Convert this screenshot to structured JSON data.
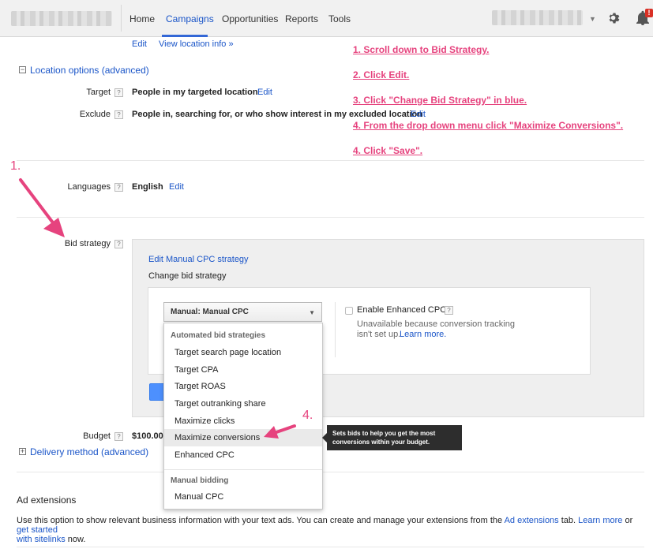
{
  "nav": {
    "tabs": [
      {
        "label": "Home"
      },
      {
        "label": "Campaigns"
      },
      {
        "label": "Opportunities"
      },
      {
        "label": "Reports"
      },
      {
        "label": "Tools"
      }
    ],
    "notification_badge": "!"
  },
  "location": {
    "edit_label": "Edit",
    "view_location_info": "View location info »",
    "section_title": "Location options (advanced)",
    "target_label": "Target",
    "target_value": "People in my targeted location",
    "target_edit": "Edit",
    "exclude_label": "Exclude",
    "exclude_value": "People in, searching for, or who show interest in my excluded location",
    "exclude_edit": "Edit"
  },
  "languages": {
    "label": "Languages",
    "value": "English",
    "edit": "Edit"
  },
  "bid_strategy": {
    "label": "Bid strategy",
    "edit_link": "Edit Manual CPC strategy",
    "change_label": "Change bid strategy",
    "selected": "Manual: Manual CPC",
    "enhanced_cpc_label": "Enable Enhanced CPC",
    "enhanced_cpc_note_1": "Unavailable because conversion tracking",
    "enhanced_cpc_note_2": "isn't set up.",
    "learn_more": "Learn more."
  },
  "dropdown": {
    "group_automated": "Automated bid strategies",
    "automated_items": [
      {
        "label": "Target search page location"
      },
      {
        "label": "Target CPA"
      },
      {
        "label": "Target ROAS"
      },
      {
        "label": "Target outranking share"
      },
      {
        "label": "Maximize clicks"
      },
      {
        "label": "Maximize conversions"
      },
      {
        "label": "Enhanced CPC"
      }
    ],
    "group_manual": "Manual bidding",
    "manual_items": [
      {
        "label": "Manual CPC"
      }
    ]
  },
  "tooltip": {
    "line1": "Sets bids to help you get the most",
    "line2": "conversions within your budget."
  },
  "budget": {
    "label": "Budget",
    "value": "$100.00/"
  },
  "delivery": {
    "section_title": "Delivery method (advanced)"
  },
  "ad_extensions": {
    "title": "Ad extensions",
    "text_1": "Use this option to show relevant business information with your text ads. You can create and manage your extensions from the ",
    "link_1": "Ad extensions",
    "text_2": " tab. ",
    "link_2": "Learn more",
    "text_3": " or ",
    "link_3a": "get started",
    "link_3b": "with sitelinks",
    "text_4": " now."
  },
  "instructions": [
    "1. Scroll down to Bid Strategy.",
    "2. Click Edit.",
    "3. Click \"Change Bid Strategy\" in blue.",
    "4.  From the drop down menu click \"Maximize Conversions\".",
    "4. Click \"Save\"."
  ],
  "annotations": {
    "step1": "1.",
    "step4": "4."
  },
  "colors": {
    "link": "#1a55c8",
    "annotation": "#e6437e",
    "primary_button": "#4d90fe"
  }
}
